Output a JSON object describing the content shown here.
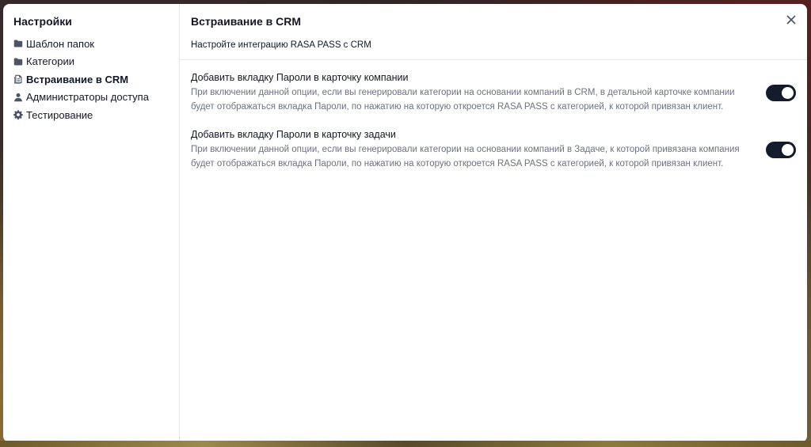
{
  "sidebar": {
    "title": "Настройки",
    "items": [
      {
        "label": "Шаблон папок",
        "icon": "folder-icon",
        "active": false
      },
      {
        "label": "Категории",
        "icon": "folder-icon",
        "active": false
      },
      {
        "label": "Встраивание в CRM",
        "icon": "document-icon",
        "active": true
      },
      {
        "label": "Администраторы доступа",
        "icon": "user-icon",
        "active": false
      },
      {
        "label": "Тестирование",
        "icon": "gear-icon",
        "active": false
      }
    ]
  },
  "content": {
    "title": "Встраивание в CRM",
    "subtitle": "Настройте интеграцию RASA PASS с CRM",
    "close_icon": "close-icon",
    "settings": [
      {
        "title": "Добавить вкладку Пароли в карточку компании",
        "description": "При включении данной опции, если вы генерировали категории на основании компаний в CRM, в детальной карточке компании будет отображаться вкладка Пароли, по нажатию на которую откроется RASA PASS с категорией, к которой привязан клиент.",
        "enabled": true
      },
      {
        "title": "Добавить вкладку Пароли в карточку задачи",
        "description": "При включении данной опции, если вы генерировали категории на основании компаний в Задаче, к которой привязана компания будет отображаться вкладка Пароли, по нажатию на которую откроется RASA PASS с категорией, к которой привязан клиент.",
        "enabled": true
      }
    ]
  },
  "colors": {
    "toggle_on": "#141c2b",
    "muted_text": "#6b7280",
    "divider": "#e5e7eb"
  }
}
